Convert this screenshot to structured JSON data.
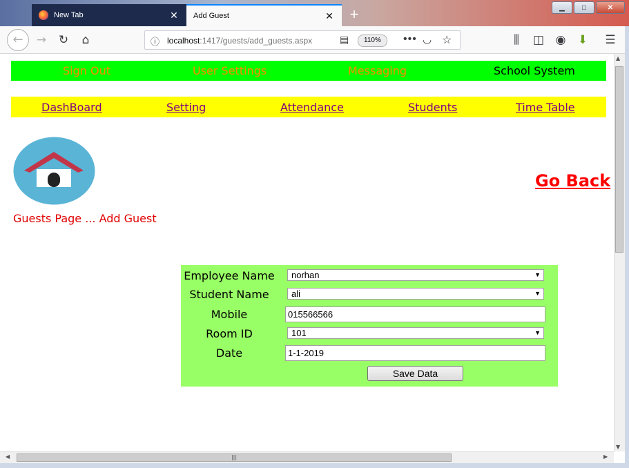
{
  "browser": {
    "tabs": [
      {
        "title": "New Tab",
        "active": false
      },
      {
        "title": "Add Guest",
        "active": true
      }
    ],
    "url_host": "localhost",
    "url_path": ":1417/guests/add_guests.aspx",
    "zoom": "110%"
  },
  "top_nav": {
    "sign_out": "Sign Out",
    "user_settings": "User Settings",
    "messaging": "Messaging",
    "system_name": "School System"
  },
  "main_nav": {
    "dashboard": "DashBoard",
    "setting": "Setting",
    "attendance": "Attendance",
    "students": "Students",
    "time_table": "Time Table"
  },
  "header": {
    "go_back": "Go Back",
    "page_title": "Guests Page ... Add Guest"
  },
  "form": {
    "employee_label": "Employee Name",
    "employee_value": "norhan",
    "student_label": "Student Name",
    "student_value": "ali",
    "mobile_label": "Mobile",
    "mobile_value": "015566566",
    "room_label": "Room ID",
    "room_value": "101",
    "date_label": "Date",
    "date_value": "1-1-2019",
    "save_label": "Save Data"
  },
  "colors": {
    "top_nav_bg": "#00ff00",
    "top_nav_link": "#ff8c00",
    "main_nav_bg": "#ffff00",
    "main_nav_link": "#800080",
    "form_bg": "#99ff66",
    "go_back": "#ff0000"
  }
}
